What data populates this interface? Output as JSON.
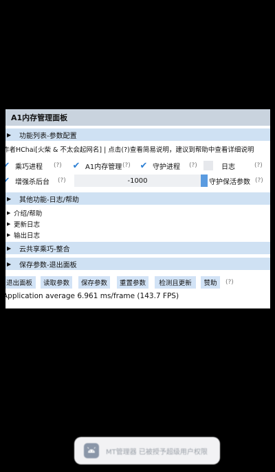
{
  "window": {
    "title": "A1内存管理面板"
  },
  "sections": {
    "features": "功能列表-参数配置",
    "other": "其他功能-日志/帮助",
    "cloud": "云共享乘巧-整合",
    "save": "保存参数-退出面板"
  },
  "info_text": "作者HChai[火柴 & 不太会起网名] | 点击(?)查看简易说明，建议到帮助中查看详细说明",
  "options": {
    "row1": [
      {
        "label": "乘巧进程",
        "checked": true
      },
      {
        "label": "A1内存管理",
        "checked": true
      },
      {
        "label": "守护进程",
        "checked": true
      },
      {
        "label": "日志",
        "checked": false
      }
    ],
    "row2": [
      {
        "label": "增强杀后台",
        "checked": true
      },
      {
        "label": "守护保活参数",
        "checked": true
      }
    ],
    "number_value": "-1000"
  },
  "help_mark": "(?)",
  "tree": {
    "intro": "介绍/帮助",
    "update_log": "更新日志",
    "output_log": "输出日志"
  },
  "buttons": {
    "exit": "退出面板",
    "read": "读取参数",
    "save": "保存参数",
    "reset": "重置参数",
    "check_update": "检测且更新",
    "donate": "赞助"
  },
  "fps_text": "Application average 6.961 ms/frame (143.7 FPS)",
  "toast": {
    "text": "MT管理器 已被授予超级用户权限",
    "icon": "android-icon"
  },
  "colors": {
    "accent": "#2c7fd4",
    "header_bg": "#cfe1f3",
    "button_bg": "#d2e3f6"
  }
}
